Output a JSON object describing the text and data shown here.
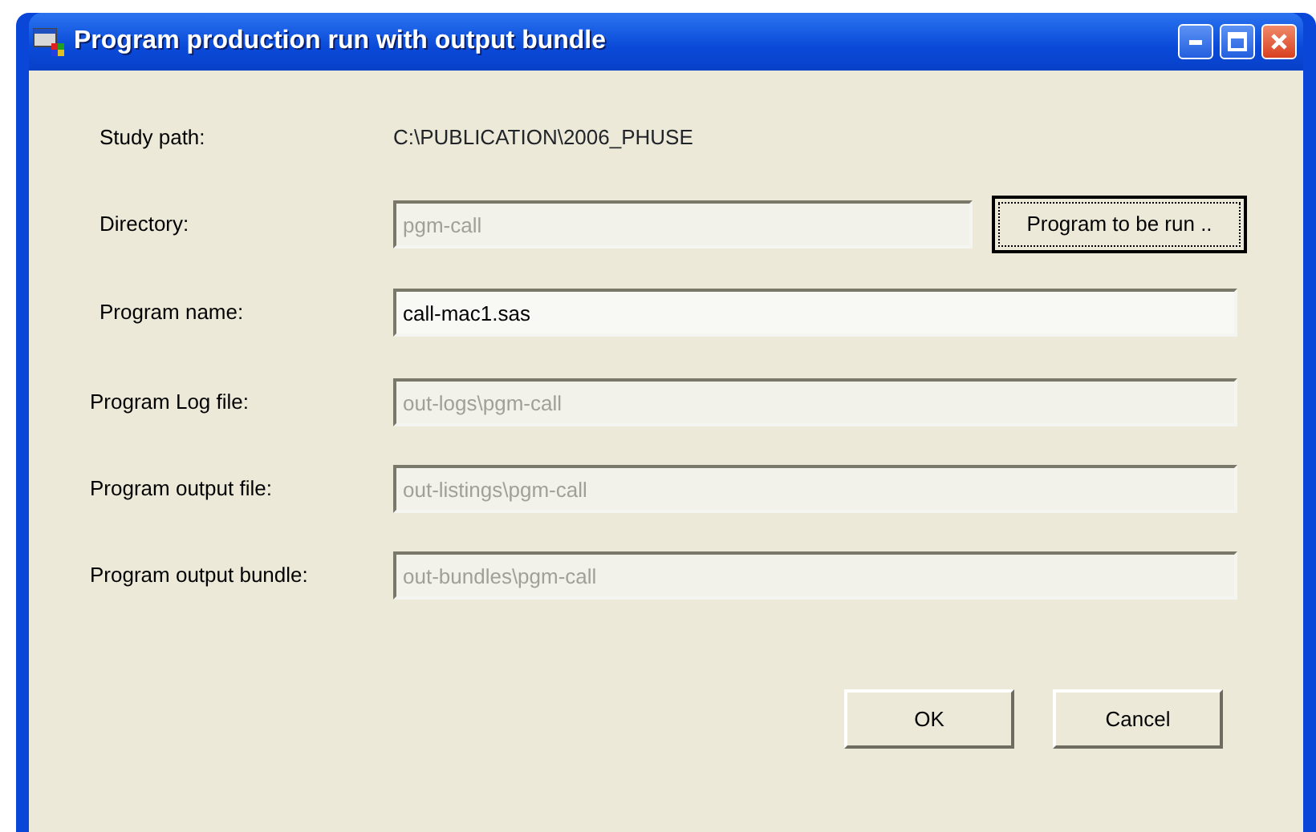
{
  "window": {
    "title": "Program production run with output bundle"
  },
  "study_path": {
    "label": "Study path:",
    "value": "C:\\PUBLICATION\\2006_PHUSE"
  },
  "fields": [
    {
      "label": "Directory:",
      "value": "pgm-call",
      "disabled": true,
      "button": "Program to be run .."
    },
    {
      "label": "Program name:",
      "value": "call-mac1.sas",
      "disabled": false
    },
    {
      "label": "Program Log file:",
      "value": "out-logs\\pgm-call",
      "disabled": true
    },
    {
      "label": "Program output file:",
      "value": "out-listings\\pgm-call",
      "disabled": true
    },
    {
      "label": "Program output bundle:",
      "value": "out-bundles\\pgm-call",
      "disabled": true
    }
  ],
  "buttons": [
    "OK",
    "Cancel"
  ]
}
